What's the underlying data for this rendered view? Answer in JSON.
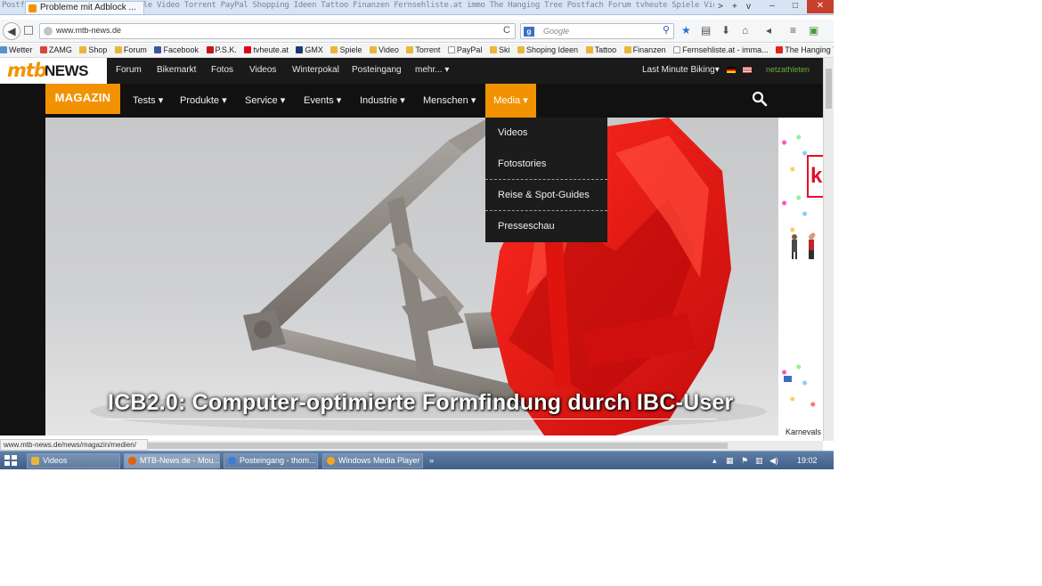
{
  "browser": {
    "active_tab_title": "Probleme mit Adblock ...",
    "tab_strip_noise": "Postfach Forum tvheute GMX Spiele Video Torrent PayPal Shopping Ideen Tattoo Finanzen Fernsehliste.at immo The Hanging Tree Postfach Forum tvheute Spiele Video Torrent PayPal Shopping",
    "url": "www.mtb-news.de",
    "search_engine_letter": "g",
    "search_placeholder": "Google",
    "back_glyph": "◀",
    "reload_glyph": "C",
    "window_controls": {
      "minimize": "–",
      "maximize": "□",
      "close": "✕"
    },
    "tab_controls": {
      "scroll_right": ">",
      "new_tab": "+",
      "list": "v"
    }
  },
  "bookmarks": [
    "Wetter",
    "ZAMG",
    "Shop",
    "Forum",
    "Facebook",
    "P.S.K.",
    "tvheute.at",
    "GMX",
    "Spiele",
    "Video",
    "Torrent",
    "PayPal",
    "Ski",
    "Shoping Ideen",
    "Tattoo",
    "Finanzen",
    "Fernsehliste.at - imma...",
    "The Hanging Tree - Th..."
  ],
  "site": {
    "logo_mtb": "mtb",
    "logo_news": "NEWS",
    "top_nav": [
      "Forum",
      "Bikemarkt",
      "Fotos",
      "Videos",
      "Winterpokal",
      "Posteingang",
      "mehr..."
    ],
    "last_minute": "Last Minute Biking",
    "netzathleten": "netzathleten",
    "magazin_label": "MAGAZIN",
    "mag_nav": [
      "Tests",
      "Produkte",
      "Service",
      "Events",
      "Industrie",
      "Menschen"
    ],
    "media_label": "Media",
    "dropdown": [
      "Videos",
      "Fotostories",
      "Reise & Spot-Guides",
      "Presseschau"
    ],
    "hero_title": "ICB2.0: Computer-optimierte Formfindung durch IBC-User",
    "ad_label": "Karnevals"
  },
  "colors": {
    "accent": "#f39200",
    "nav_dark": "#111111",
    "frame_red": "#e51414",
    "frame_grey": "#8e8984"
  },
  "status_url": "www.mtb-news.de/news/magazin/medien/",
  "taskbar": {
    "tasks": [
      "Videos",
      "MTB-News.de - Mou...",
      "Posteingang - thom...",
      "Windows Media Player"
    ],
    "clock": "19:02"
  }
}
